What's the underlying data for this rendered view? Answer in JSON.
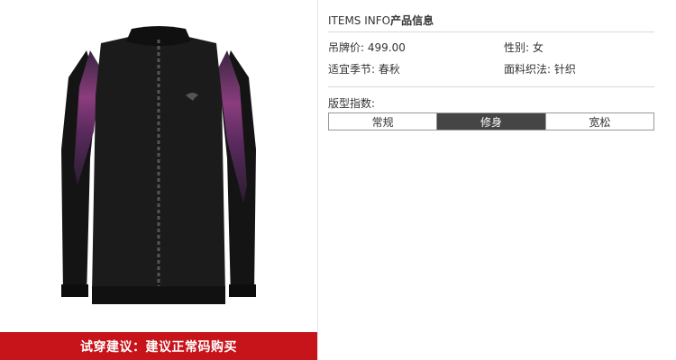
{
  "product": {
    "fit_banner": "试穿建议：建议正常码购买"
  },
  "info": {
    "title_en": "ITEMS INFO",
    "title_cn": "产品信息",
    "price_label": "吊牌价:",
    "price_value": "499.00",
    "gender_label": "性别:",
    "gender_value": "女",
    "season_label": "适宜季节:",
    "season_value": "春秋",
    "fabric_label": "面料织法:",
    "fabric_value": "针织",
    "fit_label": "版型指数:",
    "fit_options": [
      "常规",
      "修身",
      "宽松"
    ],
    "fit_selected": "修身"
  },
  "colors": {
    "banner": "#c7141b",
    "fit_active": "#454545"
  }
}
